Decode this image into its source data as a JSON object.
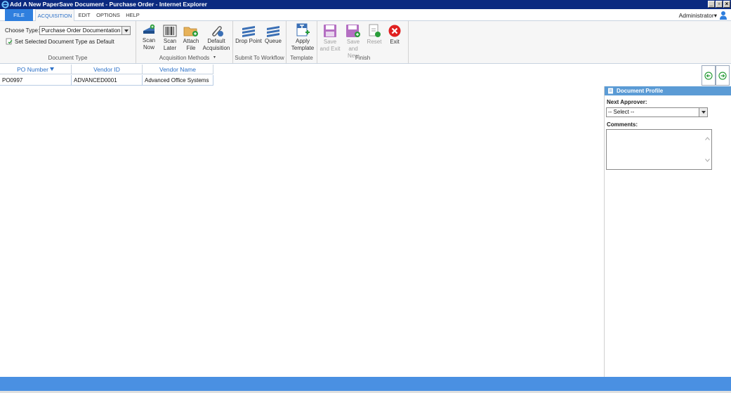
{
  "window": {
    "title": "Add A New PaperSave Document - Purchase Order - Internet Explorer",
    "icon": "ie-icon"
  },
  "menu": {
    "tabs": [
      {
        "label": "FILE"
      },
      {
        "label": "ACQUISITION"
      },
      {
        "label": "EDIT"
      },
      {
        "label": "OPTIONS"
      },
      {
        "label": "HELP"
      }
    ],
    "active_tab": "ACQUISITION",
    "user": "Administrator"
  },
  "ribbon": {
    "document_type": {
      "choose_label": "Choose Type:",
      "selected": "Purchase Order Documentation",
      "set_default_label": "Set Selected Document Type as Default",
      "group_label": "Document Type"
    },
    "acquisition": {
      "scan_now": "Scan\nNow",
      "scan_later": "Scan\nLater",
      "attach_file": "Attach\nFile",
      "default_acquisition": "Default\nAcquisition",
      "group_label": "Acquisition Methods"
    },
    "workflow": {
      "drop_point": "Drop Point",
      "queue": "Queue",
      "group_label": "Submit To Workflow"
    },
    "template": {
      "apply_template": "Apply\nTemplate",
      "group_label": "Template"
    },
    "finish": {
      "save_and_exit": "Save\nand Exit",
      "save_and_new": "Save\nand New",
      "reset": "Reset",
      "exit": "Exit",
      "group_label": "Finish"
    }
  },
  "grid": {
    "columns": [
      "PO Number",
      "Vendor ID",
      "Vendor Name"
    ],
    "rows": [
      [
        "PO0997",
        "ADVANCED0001",
        "Advanced Office Systems"
      ]
    ]
  },
  "profile": {
    "title": "Document Profile",
    "next_approver_label": "Next Approver:",
    "next_approver_value": "-- Select --",
    "comments_label": "Comments:",
    "comments_value": ""
  },
  "colors": {
    "title_bar": "#0b2a80",
    "file_tab": "#2f7fde",
    "accent_text": "#2a6fc7",
    "profile_header": "#5b9bd5",
    "status_bar": "#4a90e2"
  }
}
